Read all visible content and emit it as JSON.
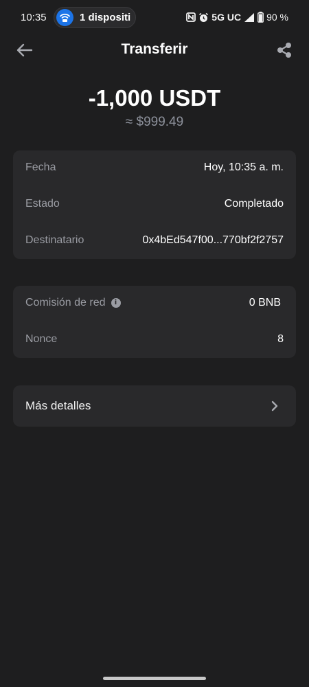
{
  "status_bar": {
    "time": "10:35",
    "device_pill": "1 dispositi",
    "network": "5G UC",
    "battery": "90 %",
    "icons": [
      "nfc-icon",
      "alarm-icon",
      "signal-icon",
      "battery-icon"
    ]
  },
  "header": {
    "title": "Transferir",
    "back_icon": "arrow-left-icon",
    "share_icon": "share-icon"
  },
  "transaction": {
    "amount": "-1,000 USDT",
    "fiat_value": "≈ $999.49"
  },
  "details": [
    {
      "label": "Fecha",
      "value": "Hoy, 10:35 a. m."
    },
    {
      "label": "Estado",
      "value": "Completado"
    },
    {
      "label": "Destinatario",
      "value": "0x4bEd547f00...770bf2f2757"
    }
  ],
  "fees": [
    {
      "label": "Comisión de red",
      "value": "0 BNB",
      "info": "i"
    },
    {
      "label": "Nonce",
      "value": "8"
    }
  ],
  "more": {
    "label": "Más detalles",
    "icon": "chevron-right-icon"
  },
  "colors": {
    "background": "#1e1e1f",
    "card": "#29292b",
    "label": "#9a9ca3",
    "accent_blue": "#1c74e8"
  }
}
